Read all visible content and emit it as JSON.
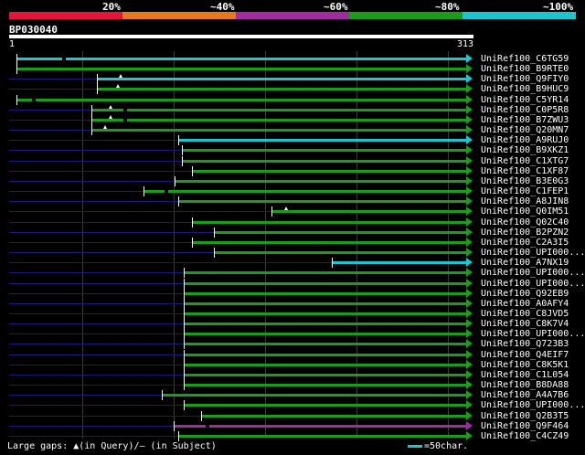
{
  "scale": {
    "labels": [
      "20%",
      "~40%",
      "~60%",
      "~80%",
      "~100%"
    ],
    "colors": [
      "#e3153b",
      "#e8781d",
      "#a02ca0",
      "#1b9c1b",
      "#1dc6ce"
    ]
  },
  "query": {
    "id": "BP030040",
    "start": "1",
    "end": "313"
  },
  "hits": [
    {
      "name": "UniRef100_C6TG59",
      "start": 1,
      "end": 313,
      "color": "#1dc6ce",
      "lead": 0,
      "gaps": [
        33
      ],
      "qmarks": []
    },
    {
      "name": "UniRef100_B9RTE0",
      "start": 1,
      "end": 313,
      "color": "#1b9c1b",
      "lead": 0,
      "gaps": [],
      "qmarks": []
    },
    {
      "name": "UniRef100_Q9FIY0",
      "start": 57,
      "end": 313,
      "color": "#1dc6ce",
      "lead": 1,
      "gaps": [],
      "qmarks": [
        72
      ]
    },
    {
      "name": "UniRef100_B9HUC9",
      "start": 57,
      "end": 313,
      "color": "#1b9c1b",
      "lead": 1,
      "gaps": [],
      "qmarks": [
        70
      ]
    },
    {
      "name": "UniRef100_C5YR14",
      "start": 1,
      "end": 313,
      "color": "#1b9c1b",
      "lead": 0,
      "gaps": [
        12
      ],
      "qmarks": []
    },
    {
      "name": "UniRef100_C0P5R8",
      "start": 53,
      "end": 313,
      "color": "#1b9c1b",
      "lead": 1,
      "gaps": [
        75
      ],
      "qmarks": [
        65
      ]
    },
    {
      "name": "UniRef100_B7ZWU3",
      "start": 53,
      "end": 313,
      "color": "#1b9c1b",
      "lead": 1,
      "gaps": [
        75
      ],
      "qmarks": [
        65
      ]
    },
    {
      "name": "UniRef100_Q20MN7",
      "start": 53,
      "end": 313,
      "color": "#1b9c1b",
      "lead": 1,
      "gaps": [],
      "qmarks": [
        61
      ]
    },
    {
      "name": "UniRef100_A9RUJ0",
      "start": 113,
      "end": 313,
      "color": "#1dc6ce",
      "lead": 1,
      "gaps": [],
      "qmarks": []
    },
    {
      "name": "UniRef100_B9XKZ1",
      "start": 116,
      "end": 313,
      "color": "#1b9c1b",
      "lead": 1,
      "gaps": [],
      "qmarks": []
    },
    {
      "name": "UniRef100_C1XTG7",
      "start": 116,
      "end": 313,
      "color": "#1b9c1b",
      "lead": 1,
      "gaps": [],
      "qmarks": []
    },
    {
      "name": "UniRef100_C1XF87",
      "start": 123,
      "end": 313,
      "color": "#1b9c1b",
      "lead": 1,
      "gaps": [],
      "qmarks": []
    },
    {
      "name": "UniRef100_B3E0G3",
      "start": 111,
      "end": 313,
      "color": "#1b9c1b",
      "lead": 1,
      "gaps": [],
      "qmarks": []
    },
    {
      "name": "UniRef100_C1FEP1",
      "start": 89,
      "end": 313,
      "color": "#1b9c1b",
      "lead": 1,
      "gaps": [
        104
      ],
      "qmarks": []
    },
    {
      "name": "UniRef100_A8JIN8",
      "start": 113,
      "end": 313,
      "color": "#1b9c1b",
      "lead": 1,
      "gaps": [],
      "qmarks": []
    },
    {
      "name": "UniRef100_Q0IM51",
      "start": 178,
      "end": 313,
      "color": "#1b9c1b",
      "lead": 1,
      "gaps": [],
      "qmarks": [
        187
      ]
    },
    {
      "name": "UniRef100_Q02C40",
      "start": 123,
      "end": 313,
      "color": "#1b9c1b",
      "lead": 1,
      "gaps": [],
      "qmarks": []
    },
    {
      "name": "UniRef100_B2PZN2",
      "start": 138,
      "end": 313,
      "color": "#1b9c1b",
      "lead": 1,
      "gaps": [],
      "qmarks": []
    },
    {
      "name": "UniRef100_C2A3I5",
      "start": 123,
      "end": 313,
      "color": "#1b9c1b",
      "lead": 1,
      "gaps": [],
      "qmarks": []
    },
    {
      "name": "UniRef100_UPI000...",
      "start": 138,
      "end": 313,
      "color": "#1b9c1b",
      "lead": 1,
      "gaps": [],
      "qmarks": []
    },
    {
      "name": "UniRef100_A7NX19",
      "start": 220,
      "end": 313,
      "color": "#1dc6ce",
      "lead": 1,
      "gaps": [],
      "qmarks": []
    },
    {
      "name": "UniRef100_UPI000...",
      "start": 117,
      "end": 313,
      "color": "#1b9c1b",
      "lead": 1,
      "gaps": [],
      "qmarks": []
    },
    {
      "name": "UniRef100_UPI000...",
      "start": 117,
      "end": 313,
      "color": "#1b9c1b",
      "lead": 1,
      "gaps": [],
      "qmarks": []
    },
    {
      "name": "UniRef100_Q92EB9",
      "start": 117,
      "end": 313,
      "color": "#1b9c1b",
      "lead": 1,
      "gaps": [],
      "qmarks": []
    },
    {
      "name": "UniRef100_A0AFY4",
      "start": 117,
      "end": 313,
      "color": "#1b9c1b",
      "lead": 1,
      "gaps": [],
      "qmarks": []
    },
    {
      "name": "UniRef100_C8JVD5",
      "start": 117,
      "end": 313,
      "color": "#1b9c1b",
      "lead": 1,
      "gaps": [],
      "qmarks": []
    },
    {
      "name": "UniRef100_C8K7V4",
      "start": 117,
      "end": 313,
      "color": "#1b9c1b",
      "lead": 1,
      "gaps": [],
      "qmarks": []
    },
    {
      "name": "UniRef100_UPI000...",
      "start": 117,
      "end": 313,
      "color": "#1b9c1b",
      "lead": 1,
      "gaps": [],
      "qmarks": []
    },
    {
      "name": "UniRef100_Q723B3",
      "start": 117,
      "end": 313,
      "color": "#1b9c1b",
      "lead": 1,
      "gaps": [],
      "qmarks": []
    },
    {
      "name": "UniRef100_Q4EIF7",
      "start": 117,
      "end": 313,
      "color": "#1b9c1b",
      "lead": 1,
      "gaps": [],
      "qmarks": []
    },
    {
      "name": "UniRef100_C8K5K1",
      "start": 117,
      "end": 313,
      "color": "#1b9c1b",
      "lead": 1,
      "gaps": [],
      "qmarks": []
    },
    {
      "name": "UniRef100_C1L054",
      "start": 117,
      "end": 313,
      "color": "#1b9c1b",
      "lead": 1,
      "gaps": [],
      "qmarks": []
    },
    {
      "name": "UniRef100_B8DA88",
      "start": 117,
      "end": 313,
      "color": "#1b9c1b",
      "lead": 1,
      "gaps": [],
      "qmarks": []
    },
    {
      "name": "UniRef100_A4A7B6",
      "start": 102,
      "end": 313,
      "color": "#1b9c1b",
      "lead": 1,
      "gaps": [],
      "qmarks": []
    },
    {
      "name": "UniRef100_UPI000...",
      "start": 117,
      "end": 313,
      "color": "#1b9c1b",
      "lead": 1,
      "gaps": [],
      "qmarks": []
    },
    {
      "name": "UniRef100_Q2B3T5",
      "start": 129,
      "end": 313,
      "color": "#1b9c1b",
      "lead": 1,
      "gaps": [],
      "qmarks": []
    },
    {
      "name": "UniRef100_Q9F464",
      "start": 110,
      "end": 313,
      "color": "#a02ca0",
      "lead": 1,
      "gaps": [
        132
      ],
      "qmarks": []
    },
    {
      "name": "UniRef100_C4CZ49",
      "start": 113,
      "end": 313,
      "color": "#1b9c1b",
      "lead": 1,
      "gaps": [],
      "qmarks": []
    }
  ],
  "legend": {
    "text": "Large gaps: ▲(in Query)/— (in Subject)",
    "key": "=50char."
  }
}
